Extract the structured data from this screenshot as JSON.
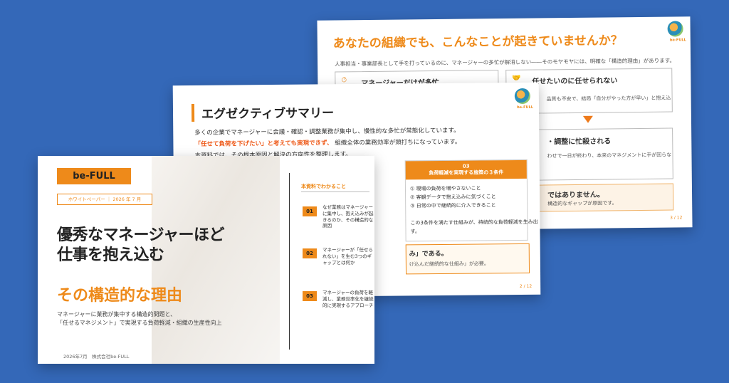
{
  "slide3": {
    "title": "あなたの組織でも、こんなことが起きていませんか？",
    "subtitle": "人事担当・事業部長として手を打っているのに、マネージャーの多忙が解消しない――そのモヤモヤには、明確な「構造的理由」があります。",
    "box1_title": "マネージャーだけが多忙",
    "box2_title": "任せたいのに任せられない",
    "box2_text": "品質も不安で、結局「自分がやった方が早い」と抱え込",
    "box3_title": "・調整に忙殺される",
    "box3_text": "わせで一日が終わり、本来のマネジメントに手が回らな",
    "box4_title": "ではありません。",
    "box4_text": "構造的なギャップが原因です。",
    "logo_text": "be-FULL",
    "page": "3 / 12"
  },
  "slide2": {
    "title": "エグゼクティブサマリー",
    "line1": "多くの企業でマネージャーに会議・確認・調整業務が集中し、慢性的な多忙が常態化しています。",
    "line2_highlight": "「任せて負荷を下げたい」と考えても実現できず、",
    "line2_rest": "組織全体の業務効率が頭打ちになっています。",
    "line3": "本資料では、その根本原因と解決の方向性を整理します。",
    "col_num": "03",
    "col_head": "負荷軽減を実現する施策の３条件",
    "items": [
      "① 現場の負荷を増やさないこと",
      "② 客観データで抱え込みに気づくこと",
      "③ 日常の中で継続的に介入できること"
    ],
    "col_note": "この3条件を満たす仕組みが、持続的な負荷軽減を生み出",
    "col_note2": "す。",
    "bottom_title": "み」である。",
    "bottom_text": "け込んだ継続的な仕組み」が必要。",
    "logo_text": "be-FULL",
    "page": "2 / 12"
  },
  "slide1": {
    "brand": "be-FULL",
    "tag": "ホワイトペーパー ｜ 2026 年 7 月",
    "title_line1": "優秀なマネージャーほど",
    "title_line2": "仕事を抱え込む",
    "title_accent": "その構造的な理由",
    "desc_line1": "マネージャーに業務が集中する構造的問題と、",
    "desc_line2": "「任せるマネジメント」で実現する負荷軽減・組織の生産性向上",
    "footer": "2026年7月　株式会社be-FULL",
    "section_label": "本資料でわかること",
    "points": [
      {
        "num": "01",
        "text": "なぜ業務はマネージャーに集中し、抱え込みが起きるのか、その構造的な原因"
      },
      {
        "num": "02",
        "text": "マネージャーが「任せられない」を生む3つのギャップとは何か"
      },
      {
        "num": "03",
        "text": "マネージャーの負荷を軽減し、業務効率化を継続的に実現するアプローチ"
      }
    ]
  }
}
